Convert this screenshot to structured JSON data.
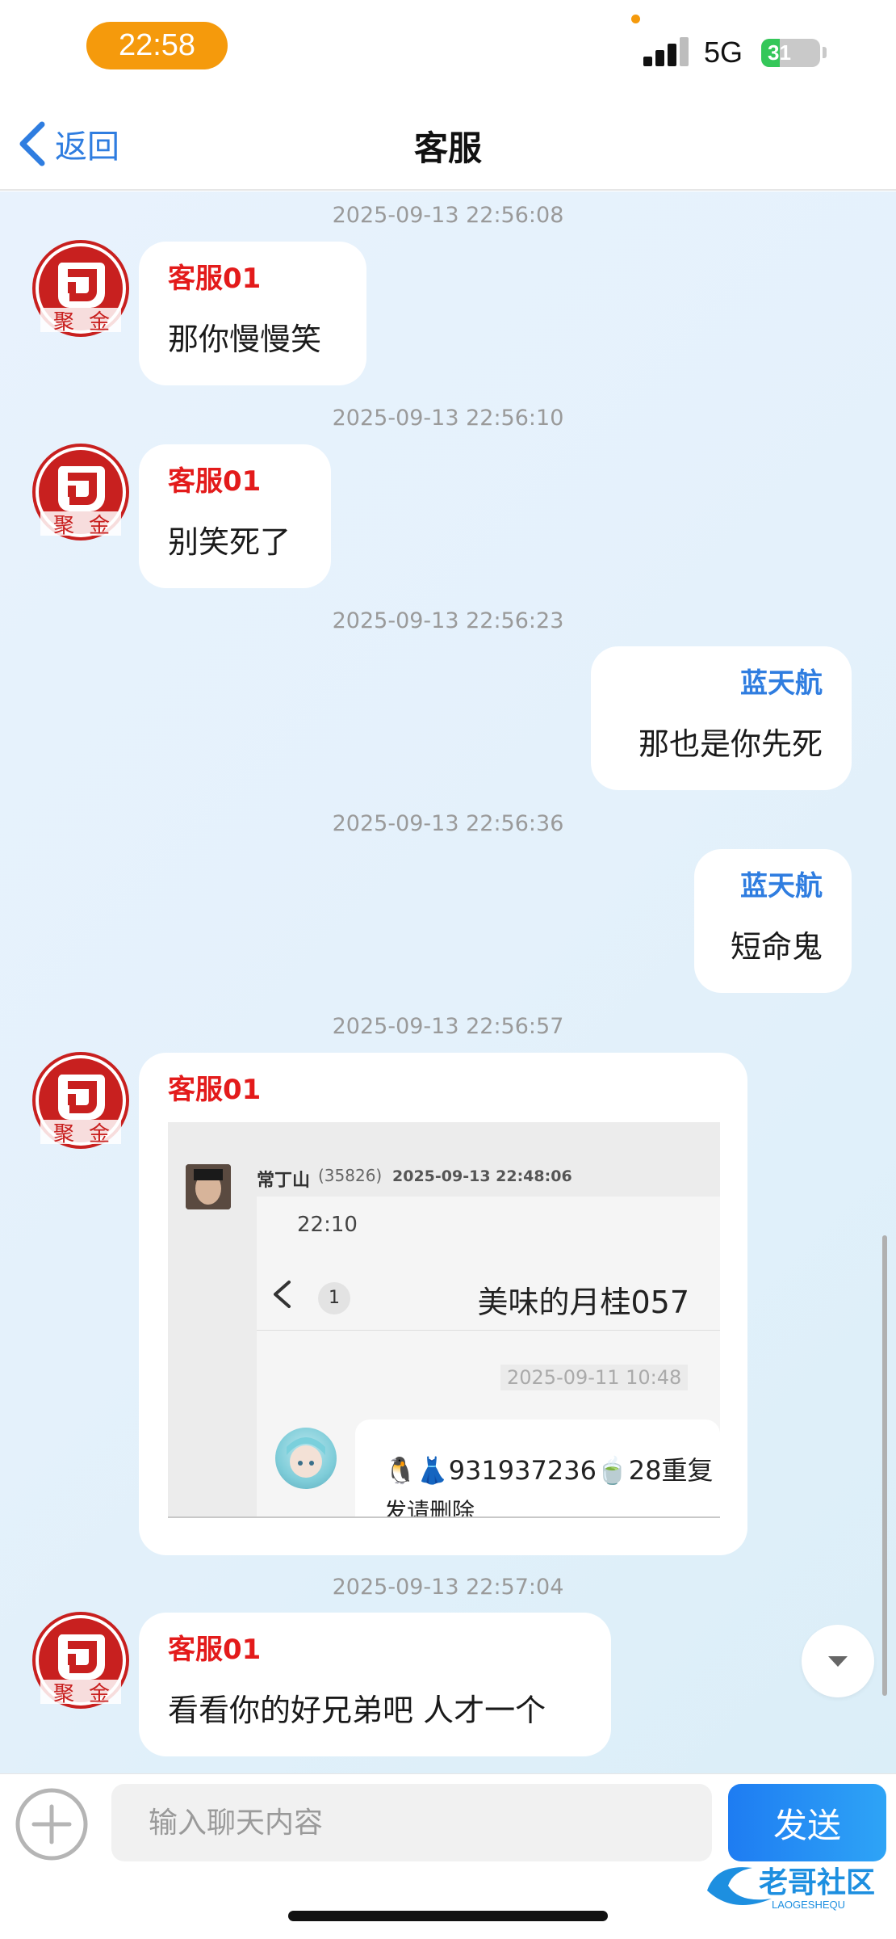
{
  "status_bar": {
    "time": "22:58",
    "network": "5G",
    "battery": "31",
    "battery_level_pct": 31,
    "battery_fill_color": "#34c759",
    "time_pill_color": "#f59a0c"
  },
  "nav": {
    "back_label": "返回",
    "title": "客服",
    "accent_color": "#2f7de0"
  },
  "colors": {
    "agent_name": "#e31b1b",
    "user_name": "#2f7de0",
    "send_button": "#1e7cf2"
  },
  "messages": [
    {
      "timestamp": "2025-09-13 22:56:08",
      "sender": "客服01",
      "side": "left",
      "text": "那你慢慢笑"
    },
    {
      "timestamp": "2025-09-13 22:56:10",
      "sender": "客服01",
      "side": "left",
      "text": "别笑死了"
    },
    {
      "timestamp": "2025-09-13 22:56:23",
      "sender": "蓝天航",
      "side": "right",
      "text": "那也是你先死"
    },
    {
      "timestamp": "2025-09-13 22:56:36",
      "sender": "蓝天航",
      "side": "right",
      "text": "短命鬼"
    },
    {
      "timestamp": "2025-09-13 22:56:57",
      "sender": "客服01",
      "side": "left",
      "image": {
        "user_name": "常丁山",
        "user_id": "(35826)",
        "post_time": "2025-09-13 22:48:06",
        "inner_time": "22:10",
        "inner_count": "1",
        "inner_title": "美味的月桂057",
        "inner_timestamp": "2025-09-11 10:48",
        "inner_message_line1": "🐧👗931937236🍵28重复",
        "inner_message_line2": "发请删除"
      }
    },
    {
      "timestamp": "2025-09-13 22:57:04",
      "sender": "客服01",
      "side": "left",
      "text": "看看你的好兄弟吧 人才一个"
    }
  ],
  "avatar_logo": {
    "text": "聚 金",
    "color": "#c8201f"
  },
  "input": {
    "placeholder": "输入聊天内容",
    "value": ""
  },
  "send_label": "发送",
  "watermark": {
    "text": "老哥社区",
    "subtext": "LAOGESHEQU"
  },
  "icons": {
    "back": "chevron-left-icon",
    "plus": "plus-circle-icon",
    "scroll_down": "chevron-down-icon"
  }
}
